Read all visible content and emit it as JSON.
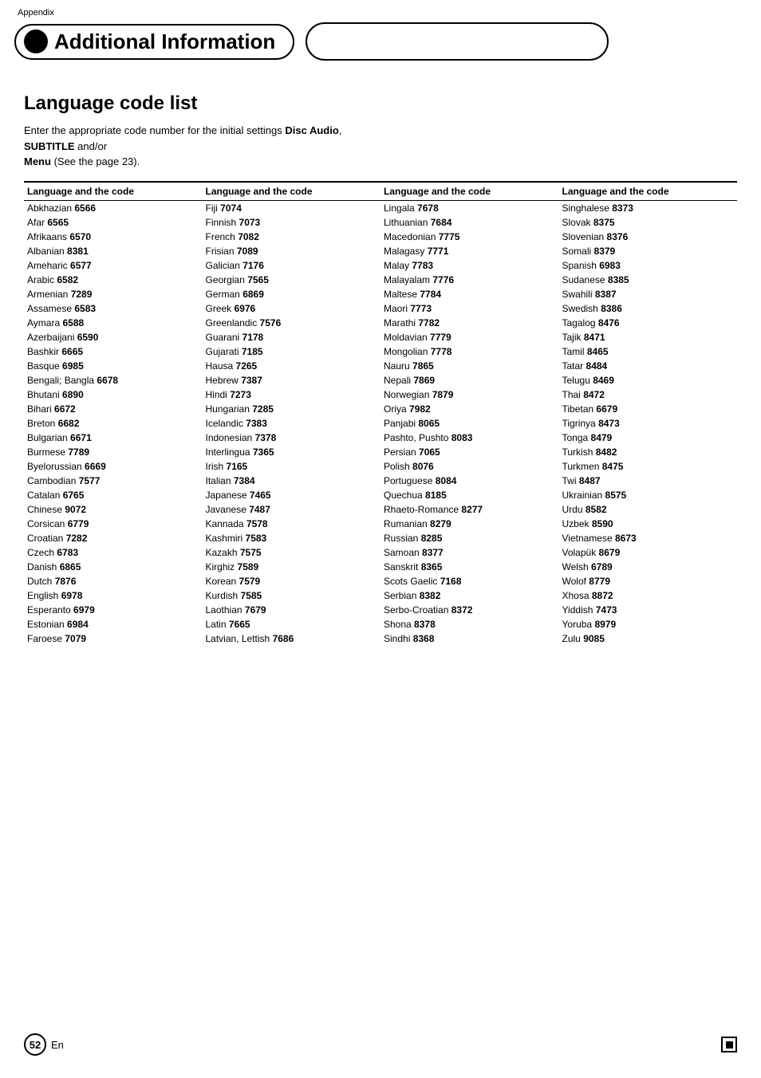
{
  "header": {
    "appendix": "Appendix",
    "title": "Additional Information",
    "page_number": "52",
    "en_label": "En"
  },
  "section": {
    "title": "Language code list",
    "intro": "Enter the appropriate code number for the initial settings ",
    "bold1": "Disc Audio",
    "sep1": ", ",
    "bold2": "SUBTITLE",
    "sep2": " and/or\n",
    "bold3": "Menu",
    "end": " (See the page 23)."
  },
  "table": {
    "col_header": "Language and the code",
    "columns": [
      [
        {
          "lang": "Abkhazian",
          "code": "6566"
        },
        {
          "lang": "Afar",
          "code": "6565"
        },
        {
          "lang": "Afrikaans",
          "code": "6570"
        },
        {
          "lang": "Albanian",
          "code": "8381"
        },
        {
          "lang": "Ameharic",
          "code": "6577"
        },
        {
          "lang": "Arabic",
          "code": "6582"
        },
        {
          "lang": "Armenian",
          "code": "7289"
        },
        {
          "lang": "Assamese",
          "code": "6583"
        },
        {
          "lang": "Aymara",
          "code": "6588"
        },
        {
          "lang": "Azerbaijani",
          "code": "6590"
        },
        {
          "lang": "Bashkir",
          "code": "6665"
        },
        {
          "lang": "Basque",
          "code": "6985"
        },
        {
          "lang": "Bengali; Bangla",
          "code": "6678"
        },
        {
          "lang": "Bhutani",
          "code": "6890"
        },
        {
          "lang": "Bihari",
          "code": "6672"
        },
        {
          "lang": "Breton",
          "code": "6682"
        },
        {
          "lang": "Bulgarian",
          "code": "6671"
        },
        {
          "lang": "Burmese",
          "code": "7789"
        },
        {
          "lang": "Byelorussian",
          "code": "6669"
        },
        {
          "lang": "Cambodian",
          "code": "7577"
        },
        {
          "lang": "Catalan",
          "code": "6765"
        },
        {
          "lang": "Chinese",
          "code": "9072"
        },
        {
          "lang": "Corsican",
          "code": "6779"
        },
        {
          "lang": "Croatian",
          "code": "7282"
        },
        {
          "lang": "Czech",
          "code": "6783"
        },
        {
          "lang": "Danish",
          "code": "6865"
        },
        {
          "lang": "Dutch",
          "code": "7876"
        },
        {
          "lang": "English",
          "code": "6978"
        },
        {
          "lang": "Esperanto",
          "code": "6979"
        },
        {
          "lang": "Estonian",
          "code": "6984"
        },
        {
          "lang": "Faroese",
          "code": "7079"
        }
      ],
      [
        {
          "lang": "Fiji",
          "code": "7074"
        },
        {
          "lang": "Finnish",
          "code": "7073"
        },
        {
          "lang": "French",
          "code": "7082"
        },
        {
          "lang": "Frisian",
          "code": "7089"
        },
        {
          "lang": "Galician",
          "code": "7176"
        },
        {
          "lang": "Georgian",
          "code": "7565"
        },
        {
          "lang": "German",
          "code": "6869"
        },
        {
          "lang": "Greek",
          "code": "6976"
        },
        {
          "lang": "Greenlandic",
          "code": "7576"
        },
        {
          "lang": "Guarani",
          "code": "7178"
        },
        {
          "lang": "Gujarati",
          "code": "7185"
        },
        {
          "lang": "Hausa",
          "code": "7265"
        },
        {
          "lang": "Hebrew",
          "code": "7387"
        },
        {
          "lang": "Hindi",
          "code": "7273"
        },
        {
          "lang": "Hungarian",
          "code": "7285"
        },
        {
          "lang": "Icelandic",
          "code": "7383"
        },
        {
          "lang": "Indonesian",
          "code": "7378"
        },
        {
          "lang": "Interlingua",
          "code": "7365"
        },
        {
          "lang": "Irish",
          "code": "7165"
        },
        {
          "lang": "Italian",
          "code": "7384"
        },
        {
          "lang": "Japanese",
          "code": "7465"
        },
        {
          "lang": "Javanese",
          "code": "7487"
        },
        {
          "lang": "Kannada",
          "code": "7578"
        },
        {
          "lang": "Kashmiri",
          "code": "7583"
        },
        {
          "lang": "Kazakh",
          "code": "7575"
        },
        {
          "lang": "Kirghiz",
          "code": "7589"
        },
        {
          "lang": "Korean",
          "code": "7579"
        },
        {
          "lang": "Kurdish",
          "code": "7585"
        },
        {
          "lang": "Laothian",
          "code": "7679"
        },
        {
          "lang": "Latin",
          "code": "7665"
        },
        {
          "lang": "Latvian, Lettish",
          "code": "7686"
        }
      ],
      [
        {
          "lang": "Lingala",
          "code": "7678"
        },
        {
          "lang": "Lithuanian",
          "code": "7684"
        },
        {
          "lang": "Macedonian",
          "code": "7775"
        },
        {
          "lang": "Malagasy",
          "code": "7771"
        },
        {
          "lang": "Malay",
          "code": "7783"
        },
        {
          "lang": "Malayalam",
          "code": "7776"
        },
        {
          "lang": "Maltese",
          "code": "7784"
        },
        {
          "lang": "Maori",
          "code": "7773"
        },
        {
          "lang": "Marathi",
          "code": "7782"
        },
        {
          "lang": "Moldavian",
          "code": "7779"
        },
        {
          "lang": "Mongolian",
          "code": "7778"
        },
        {
          "lang": "Nauru",
          "code": "7865"
        },
        {
          "lang": "Nepali",
          "code": "7869"
        },
        {
          "lang": "Norwegian",
          "code": "7879"
        },
        {
          "lang": "Oriya",
          "code": "7982"
        },
        {
          "lang": "Panjabi",
          "code": "8065"
        },
        {
          "lang": "Pashto, Pushto",
          "code": "8083"
        },
        {
          "lang": "Persian",
          "code": "7065"
        },
        {
          "lang": "Polish",
          "code": "8076"
        },
        {
          "lang": "Portuguese",
          "code": "8084"
        },
        {
          "lang": "Quechua",
          "code": "8185"
        },
        {
          "lang": "Rhaeto-Romance",
          "code": "8277"
        },
        {
          "lang": "Rumanian",
          "code": "8279"
        },
        {
          "lang": "Russian",
          "code": "8285"
        },
        {
          "lang": "Samoan",
          "code": "8377"
        },
        {
          "lang": "Sanskrit",
          "code": "8365"
        },
        {
          "lang": "Scots Gaelic",
          "code": "7168"
        },
        {
          "lang": "Serbian",
          "code": "8382"
        },
        {
          "lang": "Serbo-Croatian",
          "code": "8372"
        },
        {
          "lang": "Shona",
          "code": "8378"
        },
        {
          "lang": "Sindhi",
          "code": "8368"
        }
      ],
      [
        {
          "lang": "Singhalese",
          "code": "8373"
        },
        {
          "lang": "Slovak",
          "code": "8375"
        },
        {
          "lang": "Slovenian",
          "code": "8376"
        },
        {
          "lang": "Somali",
          "code": "8379"
        },
        {
          "lang": "Spanish",
          "code": "6983"
        },
        {
          "lang": "Sudanese",
          "code": "8385"
        },
        {
          "lang": "Swahili",
          "code": "8387"
        },
        {
          "lang": "Swedish",
          "code": "8386"
        },
        {
          "lang": "Tagalog",
          "code": "8476"
        },
        {
          "lang": "Tajik",
          "code": "8471"
        },
        {
          "lang": "Tamil",
          "code": "8465"
        },
        {
          "lang": "Tatar",
          "code": "8484"
        },
        {
          "lang": "Telugu",
          "code": "8469"
        },
        {
          "lang": "Thai",
          "code": "8472"
        },
        {
          "lang": "Tibetan",
          "code": "6679"
        },
        {
          "lang": "Tigrinya",
          "code": "8473"
        },
        {
          "lang": "Tonga",
          "code": "8479"
        },
        {
          "lang": "Turkish",
          "code": "8482"
        },
        {
          "lang": "Turkmen",
          "code": "8475"
        },
        {
          "lang": "Twi",
          "code": "8487"
        },
        {
          "lang": "Ukrainian",
          "code": "8575"
        },
        {
          "lang": "Urdu",
          "code": "8582"
        },
        {
          "lang": "Uzbek",
          "code": "8590"
        },
        {
          "lang": "Vietnamese",
          "code": "8673"
        },
        {
          "lang": "Volapük",
          "code": "8679"
        },
        {
          "lang": "Welsh",
          "code": "6789"
        },
        {
          "lang": "Wolof",
          "code": "8779"
        },
        {
          "lang": "Xhosa",
          "code": "8872"
        },
        {
          "lang": "Yiddish",
          "code": "7473"
        },
        {
          "lang": "Yoruba",
          "code": "8979"
        },
        {
          "lang": "Zulu",
          "code": "9085"
        }
      ]
    ]
  }
}
